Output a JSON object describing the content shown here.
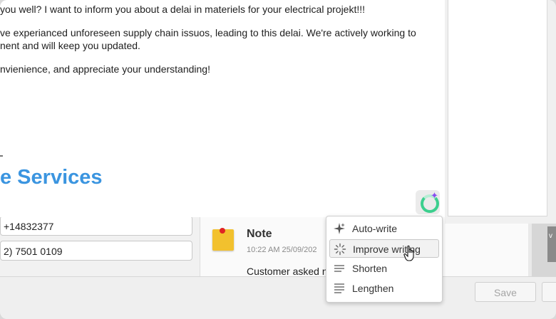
{
  "editor": {
    "lines": [
      "you well? I want to inform you about a delai in materiels for your electrical projekt!!!",
      "ve experianced unforeseen supply chain issuos, leading to this delai. We're actively working to",
      "nent and will keep you updated.",
      "nvienience, and appreciate your understanding!"
    ],
    "brand_text": "e Services"
  },
  "contact": {
    "phone_1": "+14832377",
    "phone_2": "2) 7501 0109"
  },
  "note": {
    "title": "Note",
    "time": "10:22 AM 25/09/202",
    "body": "Customer asked                              nt to be"
  },
  "ai_menu": {
    "items": [
      {
        "label": "Auto-write",
        "icon": "sparkle-icon"
      },
      {
        "label": "Improve writing",
        "icon": "sparkle-dots-icon"
      },
      {
        "label": "Shorten",
        "icon": "lines-short-icon"
      },
      {
        "label": "Lengthen",
        "icon": "lines-long-icon"
      }
    ],
    "active_index": 1
  },
  "footer": {
    "save_label": "Save"
  },
  "side_strip_label": "v",
  "colors": {
    "brand_blue": "#3b95e0",
    "ai_green": "#3ccf8e",
    "ai_purple": "#8a4ff0",
    "note_yellow": "#f2c12e"
  }
}
